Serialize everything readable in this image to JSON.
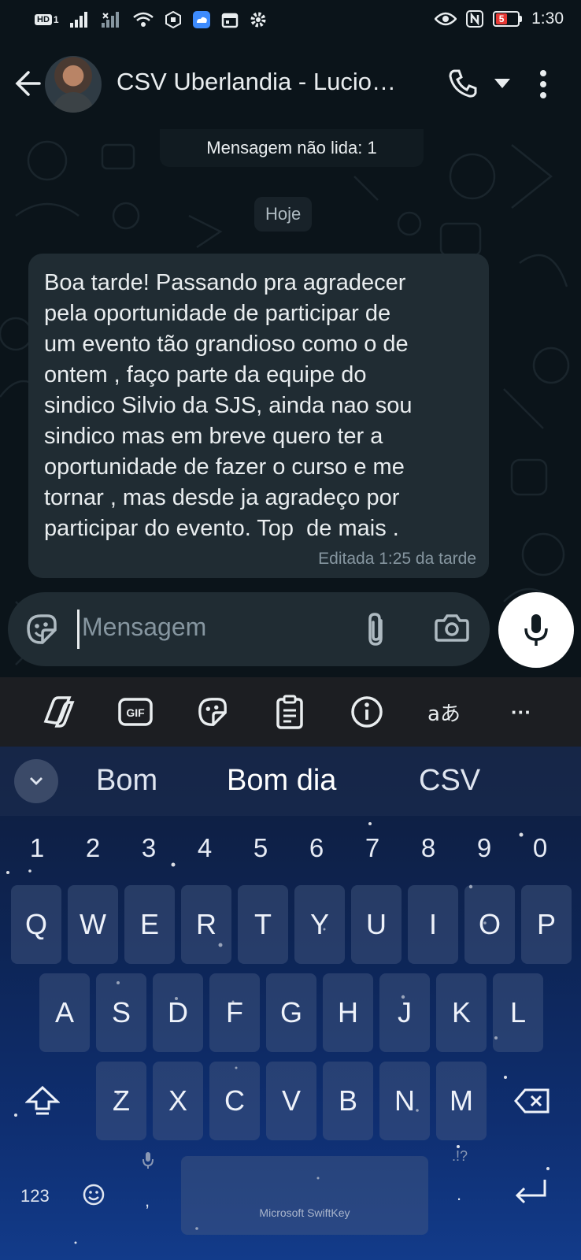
{
  "status_bar": {
    "hd_label": "HD",
    "hd_num": "1",
    "battery_level": "5",
    "time": "1:30"
  },
  "header": {
    "title": "CSV Uberlandia - Lucio…"
  },
  "chat": {
    "unread_banner": "Mensagem não lida: 1",
    "date_chip": "Hoje",
    "message": {
      "text": "Boa tarde! Passando pra agradecer\npela oportunidade de participar de\num evento tão grandioso como o de\nontem , faço parte da equipe do\nsindico Silvio da SJS, ainda nao sou\nsindico mas em breve quero ter a\noportunidade de fazer o curso e me\ntornar , mas desde ja agradeço por\nparticipar do evento. Top  de mais .",
      "meta": "Editada 1:25 da tarde"
    },
    "input_placeholder": "Mensagem"
  },
  "keyboard": {
    "toolbar_gif": "GIF",
    "toolbar_translate": "aあ",
    "toolbar_more": "···",
    "suggestions": [
      "Bom",
      "Bom dia",
      "CSV"
    ],
    "numbers": [
      "1",
      "2",
      "3",
      "4",
      "5",
      "6",
      "7",
      "8",
      "9",
      "0"
    ],
    "row1": [
      "Q",
      "W",
      "E",
      "R",
      "T",
      "Y",
      "U",
      "I",
      "O",
      "P"
    ],
    "row2": [
      "A",
      "S",
      "D",
      "F",
      "G",
      "H",
      "J",
      "K",
      "L"
    ],
    "row3": [
      "Z",
      "X",
      "C",
      "V",
      "B",
      "N",
      "M"
    ],
    "key_123": "123",
    "key_comma": ",",
    "space_label": "Microsoft SwiftKey",
    "key_punct_hint": ".!?",
    "key_period": "."
  },
  "colors": {
    "background": "#0b141a",
    "bubble": "#202c33",
    "accent_mic": "#ffffff",
    "battery_low": "#e53935"
  },
  "icons": [
    "back-arrow-icon",
    "phone-icon",
    "caret-down-icon",
    "more-vertical-icon",
    "sticker-icon",
    "attach-icon",
    "camera-icon",
    "mic-icon",
    "copilot-icon",
    "gif-icon",
    "sticker-keyboard-icon",
    "clipboard-icon",
    "info-icon",
    "translate-icon",
    "chevron-down-icon",
    "shift-icon",
    "backspace-icon",
    "emoji-icon",
    "enter-icon"
  ]
}
